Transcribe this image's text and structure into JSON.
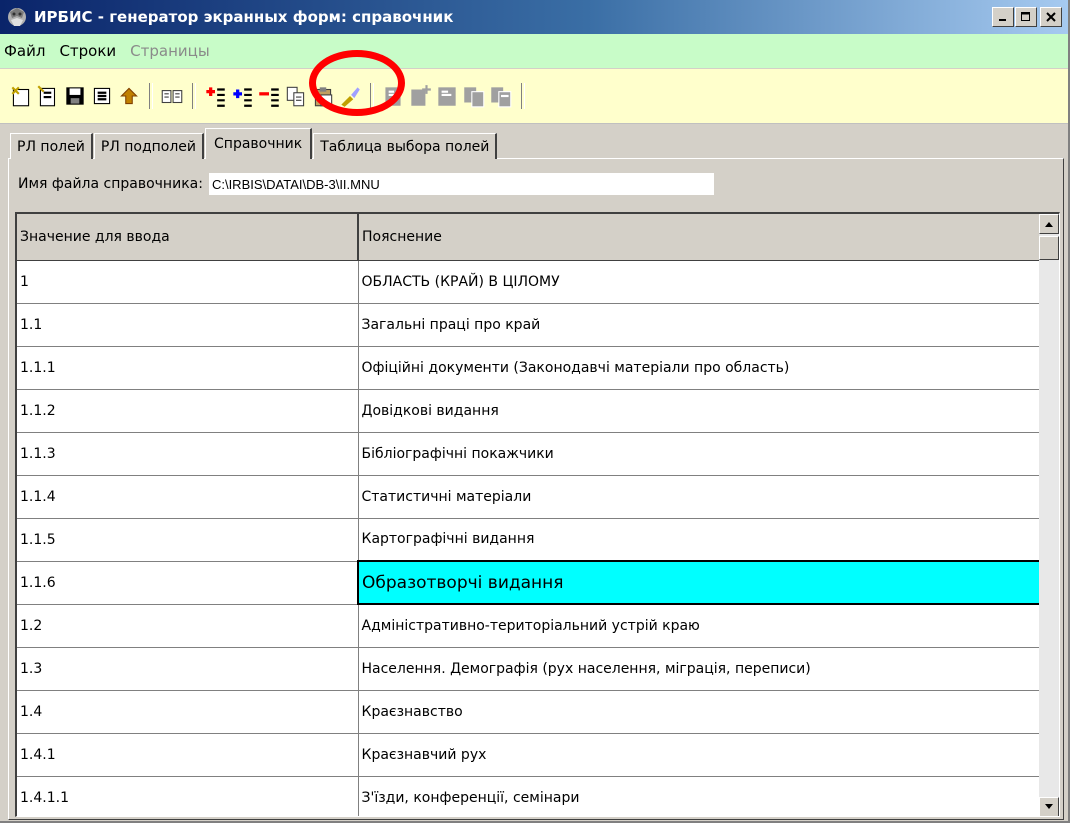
{
  "window": {
    "title": "ИРБИС - генератор экранных форм: справочник",
    "icon": "irbis-app-icon"
  },
  "menu": {
    "items": [
      {
        "label": "Файл",
        "enabled": true
      },
      {
        "label": "Строки",
        "enabled": true
      },
      {
        "label": "Страницы",
        "enabled": false
      }
    ]
  },
  "toolbar": {
    "buttons": [
      {
        "icon": "new-form-icon",
        "color": "#c0a000"
      },
      {
        "icon": "open-form-icon",
        "color": "#c0a000"
      },
      {
        "icon": "save-icon",
        "color": "#000000"
      },
      {
        "icon": "settings-icon",
        "color": "#000000"
      },
      {
        "icon": "import-icon",
        "color": "#c08000"
      },
      {
        "icon": "view-icon",
        "color": "#404040"
      },
      {
        "icon": "insert-row-before-icon",
        "color": "#ff0000"
      },
      {
        "icon": "insert-row-after-icon",
        "color": "#0000ff"
      },
      {
        "icon": "delete-row-icon",
        "color": "#ff0000"
      },
      {
        "icon": "copy-icon",
        "color": "#404040"
      },
      {
        "icon": "paste-icon",
        "color": "#404040"
      },
      {
        "icon": "clear-icon",
        "color": "#c0a000"
      },
      {
        "icon": "page-icon",
        "color": "#a0a0a0"
      },
      {
        "icon": "add-page-icon",
        "color": "#a0a0a0"
      },
      {
        "icon": "page-prop-icon",
        "color": "#a0a0a0"
      },
      {
        "icon": "copy-page-icon",
        "color": "#a0a0a0"
      },
      {
        "icon": "delete-page-icon",
        "color": "#a0a0a0"
      }
    ]
  },
  "tabs": [
    {
      "label": "РЛ полей",
      "active": false
    },
    {
      "label": "РЛ подполей",
      "active": false
    },
    {
      "label": "Справочник",
      "active": true
    },
    {
      "label": "Таблица выбора полей",
      "active": false
    }
  ],
  "file": {
    "label": "Имя файла справочника:",
    "value": "C:\\IRBIS\\DATAI\\DB-3\\II.MNU"
  },
  "grid": {
    "columns": [
      "Значение для ввода",
      "Пояснение"
    ],
    "rows": [
      [
        "1",
        "ОБЛАСТЬ (КРАЙ) В ЦІЛОМУ"
      ],
      [
        "1.1",
        "Загальні праці про край"
      ],
      [
        "1.1.1",
        "Офіційні документи (Законодавчі матеріали про область)"
      ],
      [
        "1.1.2",
        "Довідкові видання"
      ],
      [
        "1.1.3",
        "Бібліографічні покажчики"
      ],
      [
        "1.1.4",
        "Статистичні матеріали"
      ],
      [
        "1.1.5",
        "Картографічні видання"
      ],
      [
        "1.1.6",
        "Образотворчі видання"
      ],
      [
        "1.2",
        "Адміністративно-територіальний устрій краю"
      ],
      [
        "1.3",
        "Населення. Демографія (рух населення, міграція, переписи)"
      ],
      [
        "1.4",
        "Краєзнавство"
      ],
      [
        "1.4.1",
        "Краєзнавчий рух"
      ],
      [
        "1.4.1.1",
        "З'їзди, конференції, семінари"
      ]
    ],
    "selected_row": 7,
    "selected_col": 1,
    "selection_color": "#00ffff"
  },
  "colors": {
    "menubar_bg": "#c8fcc8",
    "toolbar_bg": "#ffffcc",
    "highlight": "#ff0000"
  }
}
